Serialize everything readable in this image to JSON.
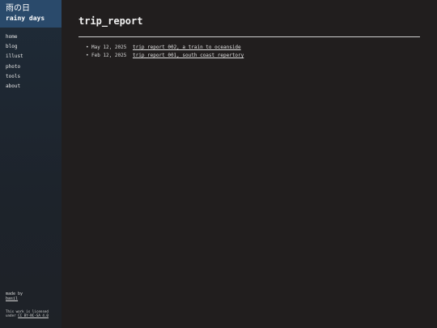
{
  "brand": {
    "title_jp": "雨の日",
    "title_en": "rainy days"
  },
  "nav": {
    "items": [
      {
        "label": "home"
      },
      {
        "label": "blog"
      },
      {
        "label": "illust"
      },
      {
        "label": "photo"
      },
      {
        "label": "tools"
      },
      {
        "label": "about"
      }
    ]
  },
  "footer": {
    "made_by": "made by",
    "author": "basil",
    "license_text": "This work is licensed under",
    "license_link": "CC BY-NC-SA 4.0"
  },
  "page": {
    "title": "trip_report"
  },
  "posts": [
    {
      "bullet": "•",
      "date": "May 12, 2025",
      "title": "trip report 002, a train to oceanside"
    },
    {
      "bullet": "•",
      "date": "Feb 12, 2025",
      "title": "trip report 001, south coast repertory"
    }
  ]
}
